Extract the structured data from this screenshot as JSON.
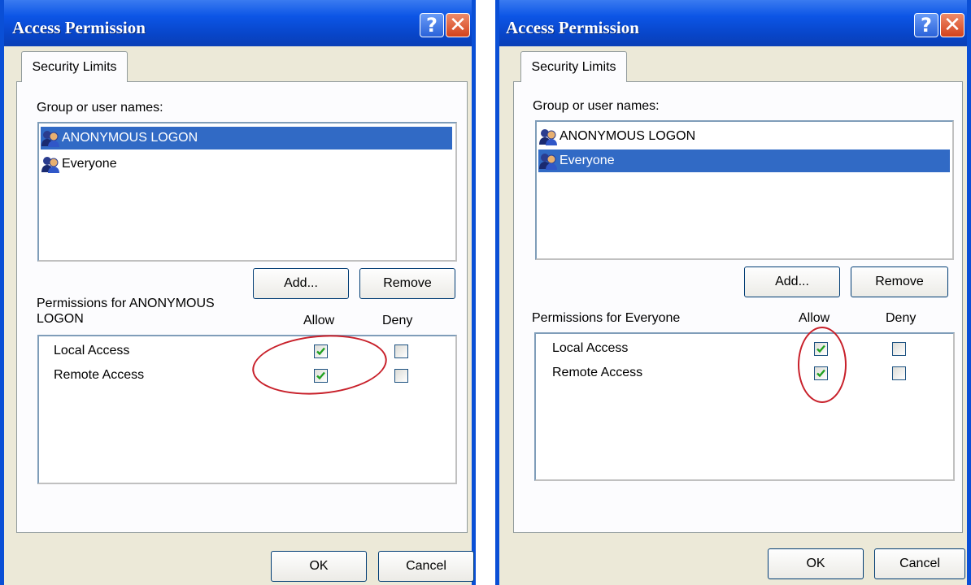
{
  "dialogs": [
    {
      "title": "Access Permission",
      "tab": "Security Limits",
      "group_label": "Group or user names:",
      "users": [
        {
          "name": "ANONYMOUS LOGON",
          "selected": true
        },
        {
          "name": "Everyone",
          "selected": false
        }
      ],
      "add_button": "Add...",
      "remove_button": "Remove",
      "permissions_label_line1": "Permissions for ANONYMOUS",
      "permissions_label_line2": "LOGON",
      "allow_header": "Allow",
      "deny_header": "Deny",
      "permissions": [
        {
          "name": "Local Access",
          "allow": true,
          "deny": false
        },
        {
          "name": "Remote Access",
          "allow": true,
          "deny": false
        }
      ],
      "ok_button": "OK",
      "cancel_button": "Cancel"
    },
    {
      "title": "Access Permission",
      "tab": "Security Limits",
      "group_label": "Group or user names:",
      "users": [
        {
          "name": "ANONYMOUS LOGON",
          "selected": false
        },
        {
          "name": "Everyone",
          "selected": true
        }
      ],
      "add_button": "Add...",
      "remove_button": "Remove",
      "permissions_label_line1": "Permissions for Everyone",
      "permissions_label_line2": "",
      "allow_header": "Allow",
      "deny_header": "Deny",
      "permissions": [
        {
          "name": "Local Access",
          "allow": true,
          "deny": false
        },
        {
          "name": "Remote Access",
          "allow": true,
          "deny": false
        }
      ],
      "ok_button": "OK",
      "cancel_button": "Cancel"
    }
  ],
  "colors": {
    "titlebar": "#0a4fd6",
    "selection": "#316ac5",
    "annotation": "#c8202a",
    "checkmark": "#21a121"
  },
  "icons": {
    "user_group": "users-icon",
    "help": "help-icon",
    "close": "close-icon"
  }
}
